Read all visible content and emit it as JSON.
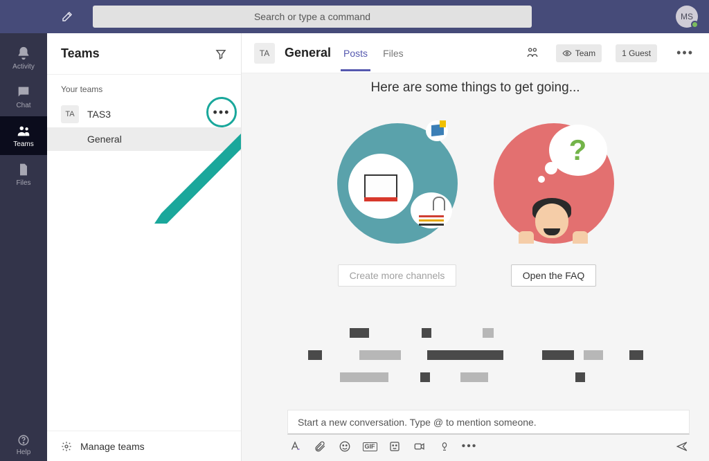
{
  "topbar": {
    "search_placeholder": "Search or type a command",
    "avatar_initials": "MS"
  },
  "rail": {
    "items": [
      {
        "icon": "bell-icon",
        "label": "Activity",
        "active": false
      },
      {
        "icon": "chat-icon",
        "label": "Chat",
        "active": false
      },
      {
        "icon": "teams-icon",
        "label": "Teams",
        "active": true
      },
      {
        "icon": "files-icon",
        "label": "Files",
        "active": false
      }
    ],
    "help_label": "Help"
  },
  "teams_panel": {
    "title": "Teams",
    "your_teams_label": "Your teams",
    "team_avatar_text": "TA",
    "team_name": "TAS3",
    "channels": [
      "General"
    ],
    "manage_label": "Manage teams"
  },
  "channel_header": {
    "avatar_text": "TA",
    "name": "General",
    "tabs": [
      {
        "label": "Posts",
        "active": true
      },
      {
        "label": "Files",
        "active": false
      }
    ],
    "team_pill": "Team",
    "guest_pill": "1 Guest"
  },
  "feed": {
    "headline": "Here are some things to get going...",
    "card_channels_label": "Create more channels",
    "card_faq_label": "Open the FAQ",
    "faq_mark": "?"
  },
  "compose": {
    "placeholder": "Start a new conversation. Type @ to mention someone.",
    "gif_label": "GIF"
  }
}
